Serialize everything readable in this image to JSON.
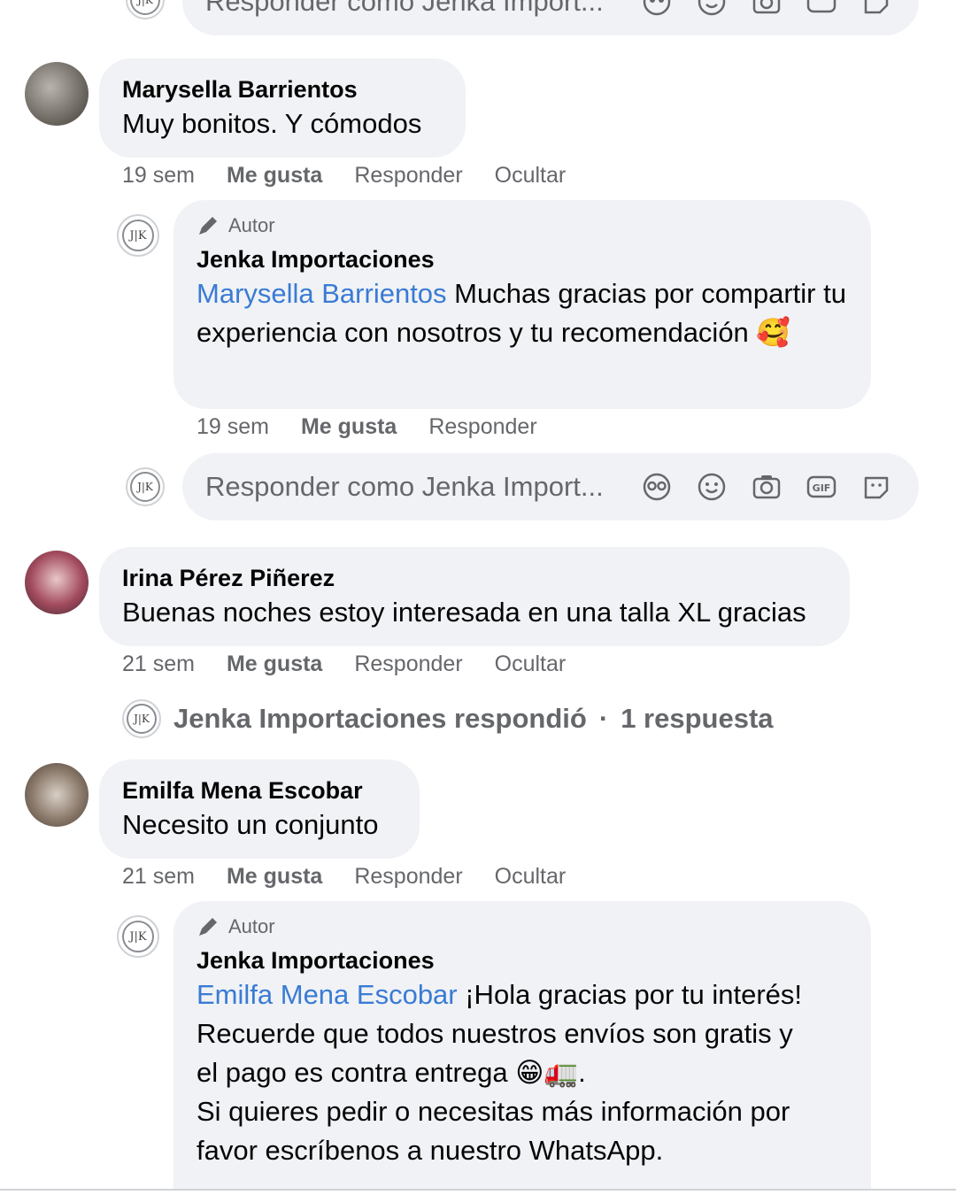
{
  "top_reply_input": {
    "placeholder": "Responder como Jenka Import..."
  },
  "comments": [
    {
      "author": "Marysella Barrientos",
      "text": "Muy bonitos. Y cómodos",
      "time": "19 sem",
      "like": "Me gusta",
      "reply": "Responder",
      "hide": "Ocultar",
      "page_reply": {
        "badge": "Autor",
        "author": "Jenka Importaciones",
        "mention": "Marysella Barrientos",
        "text": " Muchas gracias por compartir tu experiencia con nosotros y tu recomendación 🥰",
        "time": "19 sem",
        "like": "Me gusta",
        "reply": "Responder"
      },
      "reply_input": {
        "placeholder": "Responder como Jenka Import..."
      }
    },
    {
      "author": "Irina Pérez Piñerez",
      "text": "Buenas noches estoy interesada en una talla XL gracias",
      "time": "21 sem",
      "like": "Me gusta",
      "reply": "Responder",
      "hide": "Ocultar",
      "replied_summary": {
        "text": "Jenka Importaciones respondió",
        "separator": "·",
        "count": "1 respuesta"
      }
    },
    {
      "author": "Emilfa Mena Escobar",
      "text": "Necesito un conjunto",
      "time": "21 sem",
      "like": "Me gusta",
      "reply": "Responder",
      "hide": "Ocultar",
      "page_reply": {
        "badge": "Autor",
        "author": "Jenka Importaciones",
        "mention": "Emilfa Mena Escobar",
        "line1": " ¡Hola gracias por tu interés!",
        "line2": "Recuerde que todos nuestros envíos son gratis y",
        "line3": "el pago es contra entrega 😁🚛.",
        "line4": "Si quieres pedir o necesitas más información por",
        "line5": "favor escríbenos a nuestro WhatsApp."
      }
    }
  ],
  "page_avatar_text": "J|K",
  "colors": {
    "bubble": "#f0f2f5",
    "mention": "#3a7bd5",
    "meta": "#65676b"
  }
}
